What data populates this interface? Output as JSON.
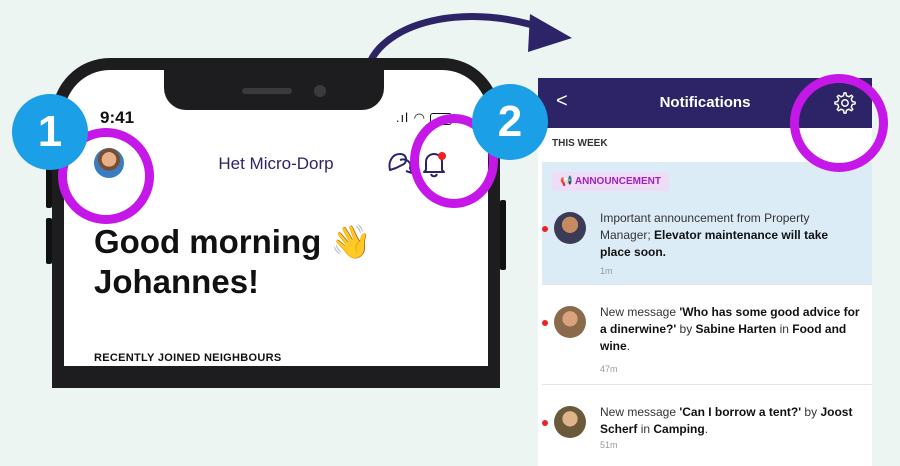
{
  "steps": {
    "one": "1",
    "two": "2"
  },
  "phone": {
    "status_time": "9:41",
    "app_title": "Het Micro-Dorp",
    "greeting_line1": "Good morning 👋",
    "greeting_line2": "Johannes!",
    "section_label": "RECENTLY JOINED NEIGHBOURS"
  },
  "notifications": {
    "back_label": "<",
    "title": "Notifications",
    "week_label": "THIS WEEK",
    "announcement_label": "ANNOUNCEMENT",
    "items": [
      {
        "pre": "Important announcement from Property Manager; ",
        "bold1": "Elevator maintenance will take place soon.",
        "mid": "",
        "bold2": "",
        "mid2": "",
        "bold3": "",
        "post": "",
        "time": "1m"
      },
      {
        "pre": "New message ",
        "bold1": "'Who has some good advice for a dinerwine?'",
        "mid": " by ",
        "bold2": "Sabine Harten",
        "mid2": " in ",
        "bold3": "Food and wine",
        "post": ".",
        "time": "47m"
      },
      {
        "pre": "New message ",
        "bold1": "'Can I borrow a tent?'",
        "mid": " by ",
        "bold2": "Joost Scherf",
        "mid2": " in ",
        "bold3": "Camping",
        "post": ".",
        "time": "51m"
      }
    ]
  },
  "colors": {
    "accent": "#2d2467",
    "highlight_ring": "#c517e8",
    "step_badge": "#1b9fe6",
    "unread_dot": "#ee2222"
  },
  "icons": [
    "flow-arrow-icon",
    "chat-icon",
    "bell-icon",
    "gear-icon",
    "back-icon",
    "megaphone-icon"
  ]
}
